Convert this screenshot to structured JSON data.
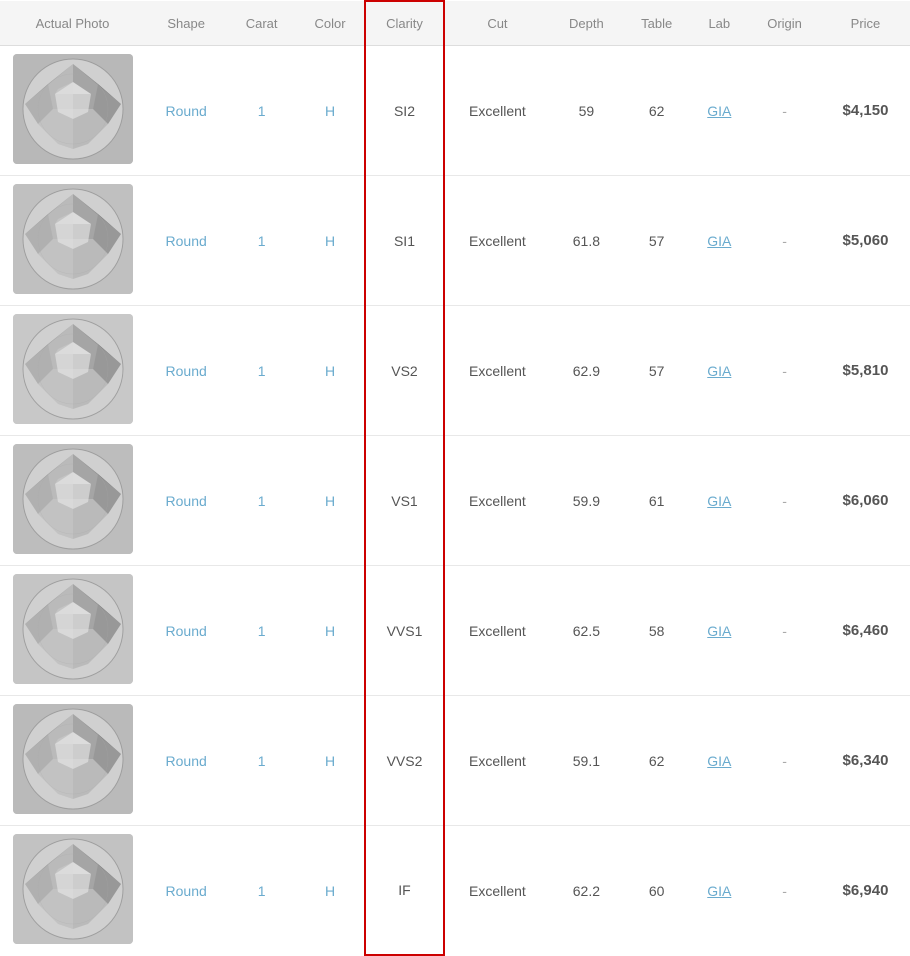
{
  "header": {
    "columns": [
      {
        "key": "photo",
        "label": "Actual Photo"
      },
      {
        "key": "shape",
        "label": "Shape"
      },
      {
        "key": "carat",
        "label": "Carat"
      },
      {
        "key": "color",
        "label": "Color"
      },
      {
        "key": "clarity",
        "label": "Clarity"
      },
      {
        "key": "cut",
        "label": "Cut"
      },
      {
        "key": "depth",
        "label": "Depth"
      },
      {
        "key": "table",
        "label": "Table"
      },
      {
        "key": "lab",
        "label": "Lab"
      },
      {
        "key": "origin",
        "label": "Origin"
      },
      {
        "key": "price",
        "label": "Price"
      }
    ]
  },
  "rows": [
    {
      "shape": "Round",
      "carat": "1",
      "color": "H",
      "clarity": "SI2",
      "cut": "Excellent",
      "depth": "59",
      "table": "62",
      "lab": "GIA",
      "origin": "-",
      "price": "$4,150"
    },
    {
      "shape": "Round",
      "carat": "1",
      "color": "H",
      "clarity": "SI1",
      "cut": "Excellent",
      "depth": "61.8",
      "table": "57",
      "lab": "GIA",
      "origin": "-",
      "price": "$5,060"
    },
    {
      "shape": "Round",
      "carat": "1",
      "color": "H",
      "clarity": "VS2",
      "cut": "Excellent",
      "depth": "62.9",
      "table": "57",
      "lab": "GIA",
      "origin": "-",
      "price": "$5,810"
    },
    {
      "shape": "Round",
      "carat": "1",
      "color": "H",
      "clarity": "VS1",
      "cut": "Excellent",
      "depth": "59.9",
      "table": "61",
      "lab": "GIA",
      "origin": "-",
      "price": "$6,060"
    },
    {
      "shape": "Round",
      "carat": "1",
      "color": "H",
      "clarity": "VVS1",
      "cut": "Excellent",
      "depth": "62.5",
      "table": "58",
      "lab": "GIA",
      "origin": "-",
      "price": "$6,460"
    },
    {
      "shape": "Round",
      "carat": "1",
      "color": "H",
      "clarity": "VVS2",
      "cut": "Excellent",
      "depth": "59.1",
      "table": "62",
      "lab": "GIA",
      "origin": "-",
      "price": "$6,340"
    },
    {
      "shape": "Round",
      "carat": "1",
      "color": "H",
      "clarity": "IF",
      "cut": "Excellent",
      "depth": "62.2",
      "table": "60",
      "lab": "GIA",
      "origin": "-",
      "price": "$6,940"
    }
  ]
}
